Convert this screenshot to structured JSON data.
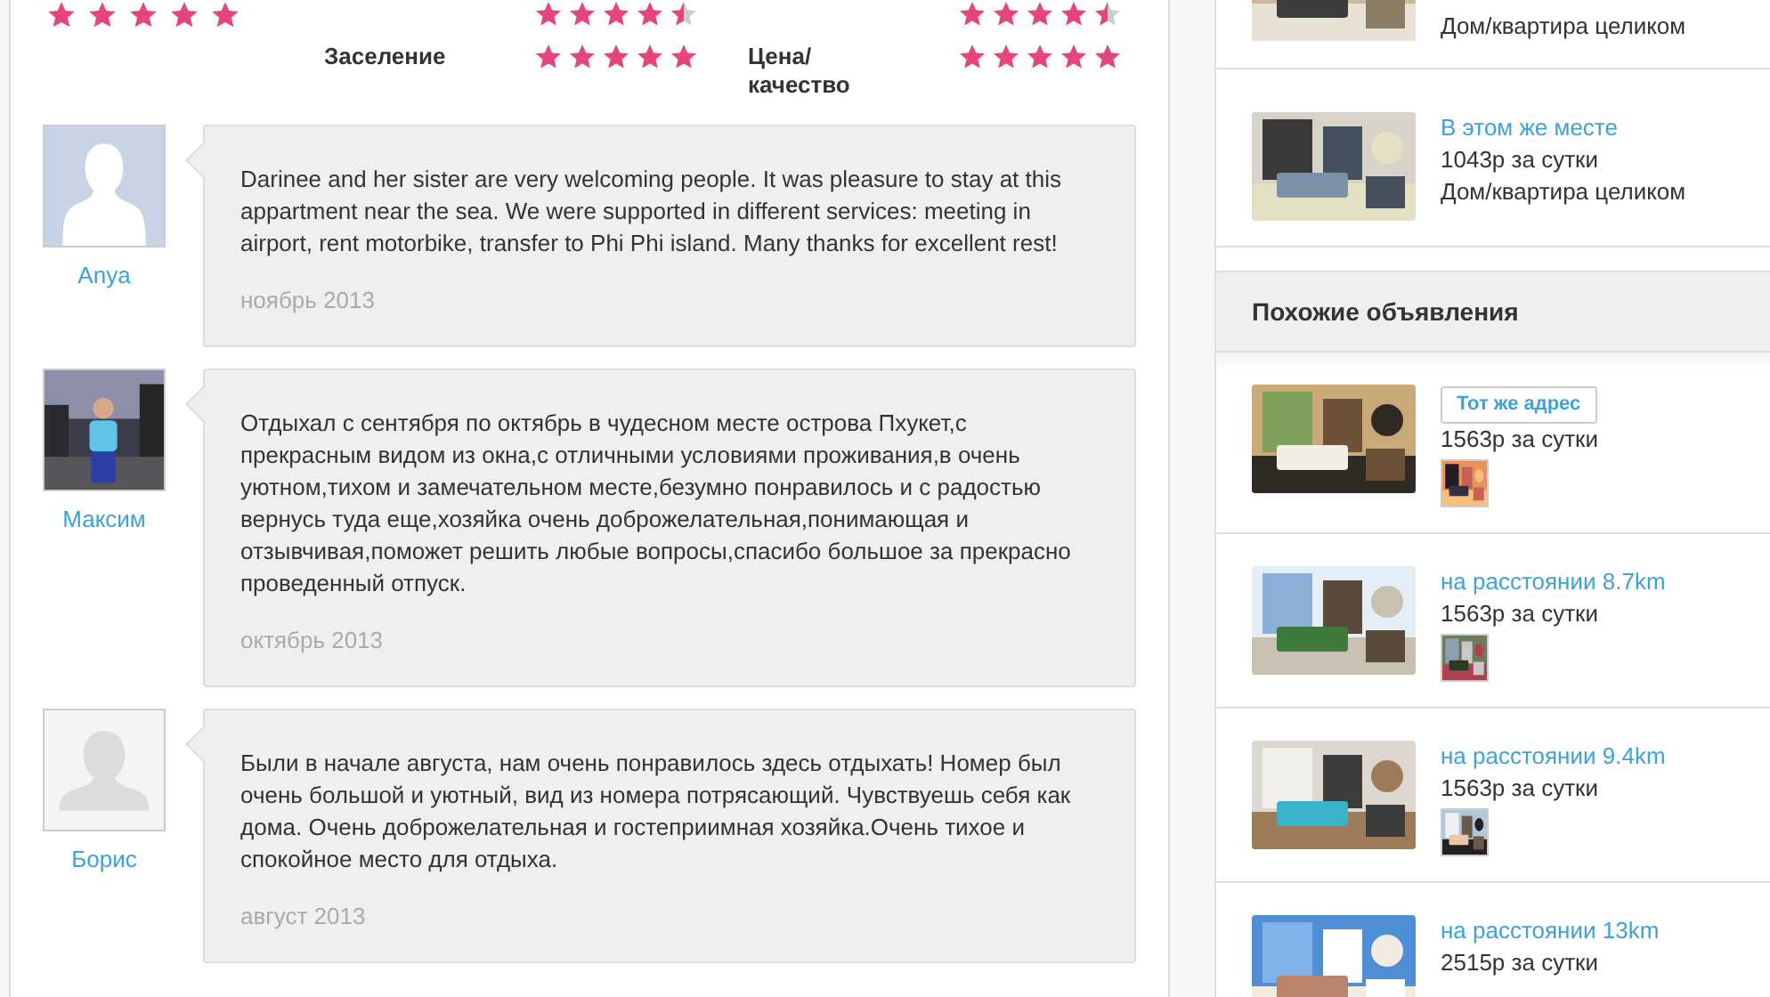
{
  "ratings": {
    "overall": {
      "stars": 5
    },
    "criteria": [
      {
        "stars": 4.5
      },
      {
        "stars": 4.5
      },
      {
        "label": "Заселение",
        "stars": 5
      },
      {
        "label": "Цена/ качество",
        "stars": 5
      }
    ]
  },
  "reviews": [
    {
      "author": "Anya",
      "text": "Darinee and her sister are very welcoming people. It was pleasure to stay at this appartment near the sea. We were supported in different services: meeting in airport, rent motorbike, transfer to Phi Phi island. Many thanks for excellent rest!",
      "date": "ноябрь 2013"
    },
    {
      "author": "Максим",
      "text": "Отдыхал с сентября по октябрь в чудесном месте острова Пхукет,с прекрасным видом из окна,с отличными условиями проживания,в очень уютном,тихом и замечательном месте,безумно понравилось и с радостью вернусь туда еще,хозяйка очень доброжелательная,понимающая и отзывчивая,поможет решить любые вопросы,спасибо большое за прекрасно проведенный отпуск.",
      "date": "октябрь 2013"
    },
    {
      "author": "Борис",
      "text": "Были в начале августа, нам очень понравилось здесь отдыхать! Номер был очень большой и уютный, вид из номера потрясающий. Чувствуешь себя как дома. Очень доброжелательная и гостеприимная хозяйка.Очень тихое и спокойное место для отдыха.",
      "date": "август 2013"
    }
  ],
  "nearby": [
    {
      "type": "Дом/квартира целиком"
    },
    {
      "link": "В этом же месте",
      "price": "1043р за сутки",
      "type": "Дом/квартира целиком"
    }
  ],
  "similar": {
    "title": "Похожие объявления",
    "items": [
      {
        "tag": "Тот же адрес",
        "price": "1563р за сутки",
        "host_photo": true
      },
      {
        "link": "на расстоянии 8.7km",
        "price": "1563р за сутки",
        "host_photo": true
      },
      {
        "link": "на расстоянии 9.4km",
        "price": "1563р за сутки",
        "host_photo": true
      },
      {
        "link": "на расстоянии 13km",
        "price": "2515р за сутки",
        "host_photo": false
      }
    ]
  }
}
